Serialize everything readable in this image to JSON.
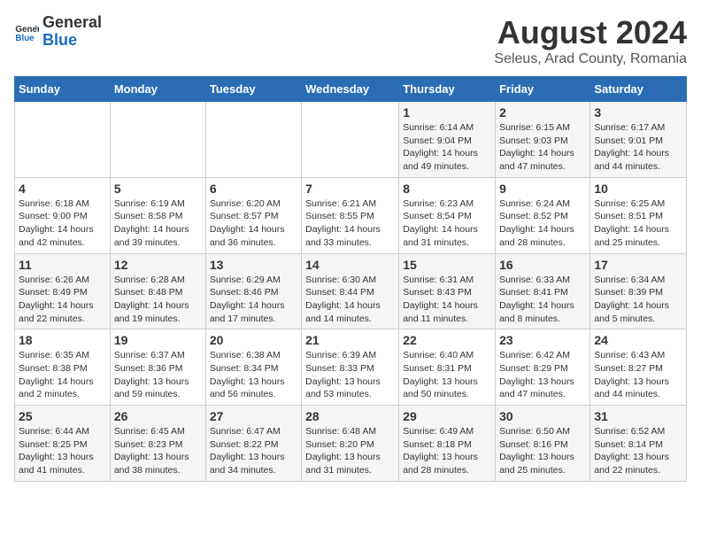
{
  "logo": {
    "general": "General",
    "blue": "Blue"
  },
  "title": "August 2024",
  "subtitle": "Seleus, Arad County, Romania",
  "days_of_week": [
    "Sunday",
    "Monday",
    "Tuesday",
    "Wednesday",
    "Thursday",
    "Friday",
    "Saturday"
  ],
  "weeks": [
    [
      {
        "day": "",
        "info": ""
      },
      {
        "day": "",
        "info": ""
      },
      {
        "day": "",
        "info": ""
      },
      {
        "day": "",
        "info": ""
      },
      {
        "day": "1",
        "info": "Sunrise: 6:14 AM\nSunset: 9:04 PM\nDaylight: 14 hours and 49 minutes."
      },
      {
        "day": "2",
        "info": "Sunrise: 6:15 AM\nSunset: 9:03 PM\nDaylight: 14 hours and 47 minutes."
      },
      {
        "day": "3",
        "info": "Sunrise: 6:17 AM\nSunset: 9:01 PM\nDaylight: 14 hours and 44 minutes."
      }
    ],
    [
      {
        "day": "4",
        "info": "Sunrise: 6:18 AM\nSunset: 9:00 PM\nDaylight: 14 hours and 42 minutes."
      },
      {
        "day": "5",
        "info": "Sunrise: 6:19 AM\nSunset: 8:58 PM\nDaylight: 14 hours and 39 minutes."
      },
      {
        "day": "6",
        "info": "Sunrise: 6:20 AM\nSunset: 8:57 PM\nDaylight: 14 hours and 36 minutes."
      },
      {
        "day": "7",
        "info": "Sunrise: 6:21 AM\nSunset: 8:55 PM\nDaylight: 14 hours and 33 minutes."
      },
      {
        "day": "8",
        "info": "Sunrise: 6:23 AM\nSunset: 8:54 PM\nDaylight: 14 hours and 31 minutes."
      },
      {
        "day": "9",
        "info": "Sunrise: 6:24 AM\nSunset: 8:52 PM\nDaylight: 14 hours and 28 minutes."
      },
      {
        "day": "10",
        "info": "Sunrise: 6:25 AM\nSunset: 8:51 PM\nDaylight: 14 hours and 25 minutes."
      }
    ],
    [
      {
        "day": "11",
        "info": "Sunrise: 6:26 AM\nSunset: 8:49 PM\nDaylight: 14 hours and 22 minutes."
      },
      {
        "day": "12",
        "info": "Sunrise: 6:28 AM\nSunset: 8:48 PM\nDaylight: 14 hours and 19 minutes."
      },
      {
        "day": "13",
        "info": "Sunrise: 6:29 AM\nSunset: 8:46 PM\nDaylight: 14 hours and 17 minutes."
      },
      {
        "day": "14",
        "info": "Sunrise: 6:30 AM\nSunset: 8:44 PM\nDaylight: 14 hours and 14 minutes."
      },
      {
        "day": "15",
        "info": "Sunrise: 6:31 AM\nSunset: 8:43 PM\nDaylight: 14 hours and 11 minutes."
      },
      {
        "day": "16",
        "info": "Sunrise: 6:33 AM\nSunset: 8:41 PM\nDaylight: 14 hours and 8 minutes."
      },
      {
        "day": "17",
        "info": "Sunrise: 6:34 AM\nSunset: 8:39 PM\nDaylight: 14 hours and 5 minutes."
      }
    ],
    [
      {
        "day": "18",
        "info": "Sunrise: 6:35 AM\nSunset: 8:38 PM\nDaylight: 14 hours and 2 minutes."
      },
      {
        "day": "19",
        "info": "Sunrise: 6:37 AM\nSunset: 8:36 PM\nDaylight: 13 hours and 59 minutes."
      },
      {
        "day": "20",
        "info": "Sunrise: 6:38 AM\nSunset: 8:34 PM\nDaylight: 13 hours and 56 minutes."
      },
      {
        "day": "21",
        "info": "Sunrise: 6:39 AM\nSunset: 8:33 PM\nDaylight: 13 hours and 53 minutes."
      },
      {
        "day": "22",
        "info": "Sunrise: 6:40 AM\nSunset: 8:31 PM\nDaylight: 13 hours and 50 minutes."
      },
      {
        "day": "23",
        "info": "Sunrise: 6:42 AM\nSunset: 8:29 PM\nDaylight: 13 hours and 47 minutes."
      },
      {
        "day": "24",
        "info": "Sunrise: 6:43 AM\nSunset: 8:27 PM\nDaylight: 13 hours and 44 minutes."
      }
    ],
    [
      {
        "day": "25",
        "info": "Sunrise: 6:44 AM\nSunset: 8:25 PM\nDaylight: 13 hours and 41 minutes."
      },
      {
        "day": "26",
        "info": "Sunrise: 6:45 AM\nSunset: 8:23 PM\nDaylight: 13 hours and 38 minutes."
      },
      {
        "day": "27",
        "info": "Sunrise: 6:47 AM\nSunset: 8:22 PM\nDaylight: 13 hours and 34 minutes."
      },
      {
        "day": "28",
        "info": "Sunrise: 6:48 AM\nSunset: 8:20 PM\nDaylight: 13 hours and 31 minutes."
      },
      {
        "day": "29",
        "info": "Sunrise: 6:49 AM\nSunset: 8:18 PM\nDaylight: 13 hours and 28 minutes."
      },
      {
        "day": "30",
        "info": "Sunrise: 6:50 AM\nSunset: 8:16 PM\nDaylight: 13 hours and 25 minutes."
      },
      {
        "day": "31",
        "info": "Sunrise: 6:52 AM\nSunset: 8:14 PM\nDaylight: 13 hours and 22 minutes."
      }
    ]
  ]
}
